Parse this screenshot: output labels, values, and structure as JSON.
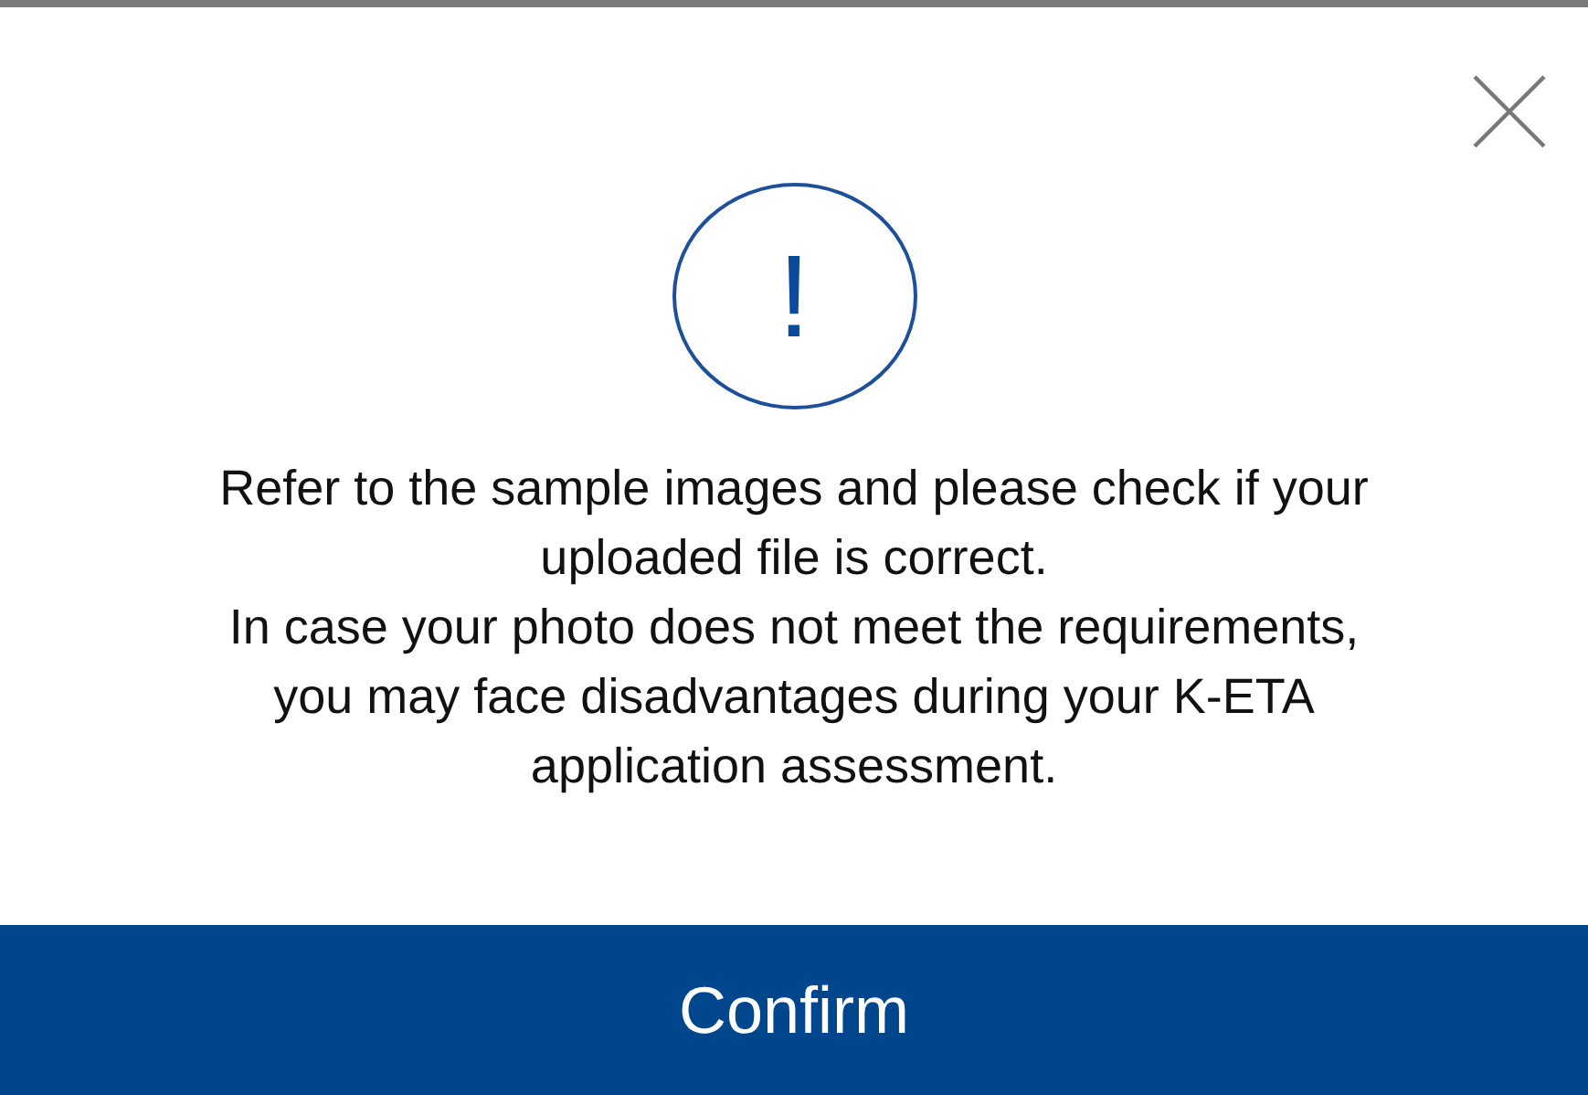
{
  "dialog": {
    "icon": "!",
    "message": [
      "Refer to the sample images and please check if your uploaded file is correct.",
      "In case your photo does not meet the requirements, you may face disadvantages during your K-ETA application assessment."
    ],
    "buttons": [
      "Confirm"
    ]
  }
}
